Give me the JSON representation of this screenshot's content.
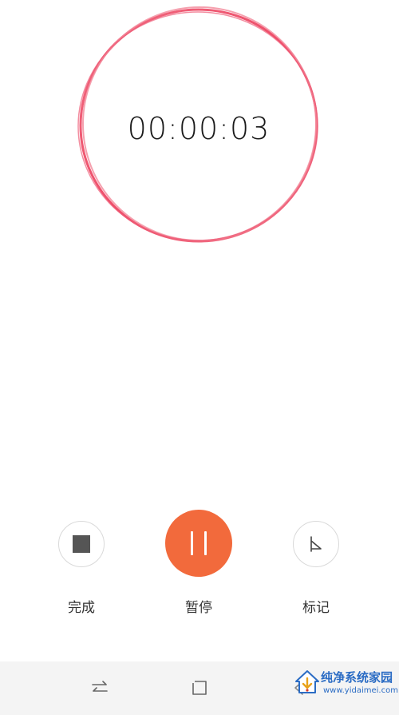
{
  "timer": {
    "elapsed": "00:00:03"
  },
  "controls": {
    "stop_label": "完成",
    "pause_label": "暂停",
    "mark_label": "标记"
  },
  "nav": {
    "icons": [
      "swap-icon",
      "square-icon",
      "back-icon"
    ]
  },
  "watermark": {
    "title": "纯净系统家园",
    "url": "www.yidaimei.com"
  },
  "colors": {
    "ring": "#f0506e",
    "pause_button": "#f26a3c",
    "stop_icon": "#555555",
    "nav_background": "#f4f4f4",
    "watermark": "#2b6cc4"
  }
}
